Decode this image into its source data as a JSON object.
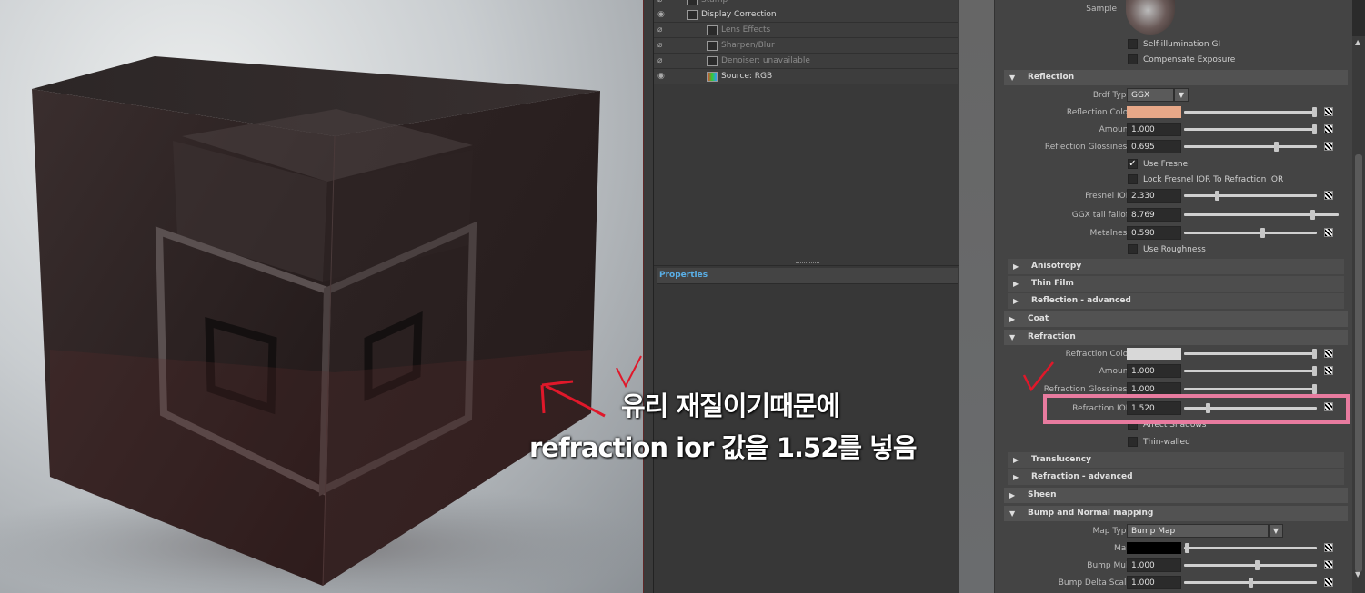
{
  "annotation": {
    "line1": "유리 재질이기때문에",
    "line2": "refraction ior 값을 1.52를 넣음"
  },
  "layers": [
    {
      "label": "Stamp",
      "dim": true,
      "indent": false
    },
    {
      "label": "Display Correction",
      "dim": false,
      "indent": false
    },
    {
      "label": "Lens Effects",
      "dim": true,
      "indent": true
    },
    {
      "label": "Sharpen/Blur",
      "dim": true,
      "indent": true
    },
    {
      "label": "Denoiser: unavailable",
      "dim": true,
      "indent": true
    },
    {
      "label": "Source: RGB",
      "dim": false,
      "indent": true
    }
  ],
  "properties_tab": "Properties",
  "attr": {
    "sample_label": "Sample",
    "self_illum": "Self-illumination GI",
    "compensate": "Compensate Exposure",
    "sections": {
      "reflection": "Reflection",
      "anisotropy": "Anisotropy",
      "thin_film": "Thin Film",
      "reflection_adv": "Reflection - advanced",
      "coat": "Coat",
      "refraction": "Refraction",
      "translucency": "Translucency",
      "refraction_adv": "Refraction - advanced",
      "sheen": "Sheen",
      "bump": "Bump and Normal mapping"
    },
    "brdf_label": "Brdf Type",
    "brdf_value": "GGX",
    "refl_color_label": "Reflection Color",
    "refl_color": "#e8a888",
    "amount_label": "Amount",
    "refl_amount": "1.000",
    "refl_gloss_label": "Reflection Glossiness",
    "refl_gloss": "0.695",
    "use_fresnel": "Use Fresnel",
    "lock_fresnel": "Lock Fresnel IOR To Refraction IOR",
    "fresnel_ior_label": "Fresnel IOR",
    "fresnel_ior": "2.330",
    "ggx_label": "GGX tail falloff",
    "ggx": "8.769",
    "metal_label": "Metalness",
    "metal": "0.590",
    "use_rough": "Use Roughness",
    "refr_color_label": "Refraction Color",
    "refr_color": "#d8d8d8",
    "refr_amount": "1.000",
    "refr_gloss_label": "Refraction Glossiness",
    "refr_gloss": "1.000",
    "refr_ior_label": "Refraction IOR",
    "refr_ior": "1.520",
    "affect_shadows": "Affect Shadows",
    "thin_walled": "Thin-walled",
    "map_type_label": "Map Type",
    "map_type": "Bump Map",
    "map_label": "Map",
    "bump_mult_label": "Bump Mult",
    "bump_mult": "1.000",
    "bump_delta_label": "Bump Delta Scale",
    "bump_delta": "1.000"
  }
}
